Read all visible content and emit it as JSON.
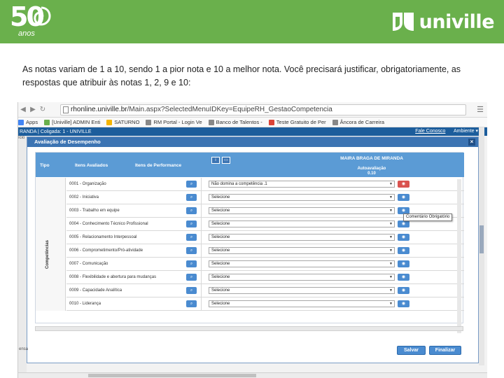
{
  "banner": {
    "logo_number": "50",
    "logo_sub": "anos",
    "brand": "univille",
    "color": "#6ab04c"
  },
  "intro_text": "As notas variam de 1 a 10, sendo 1 a pior nota e 10 a melhor nota. Você precisará justificar, obrigatoriamente, as respostas que atribuir às notas 1, 2, 9 e 10:",
  "browser": {
    "url_host": "rhonline.univille.br",
    "url_path": "/Main.aspx?SelectedMenuIDKey=EquipeRH_GestaoCompetencia",
    "bookmarks": [
      {
        "label": "Apps",
        "color": "#4285f4"
      },
      {
        "label": "[Univille] ADMIN Enti",
        "color": "#6ab04c"
      },
      {
        "label": "SATURNO",
        "color": "#f4b400"
      },
      {
        "label": "RM Portal - Login Ve",
        "color": "#888888"
      },
      {
        "label": "Banco de Talentos -",
        "color": "#888888"
      },
      {
        "label": "Teste Gratuito de Per",
        "color": "#db4437"
      },
      {
        "label": "Âncora de Carreira",
        "color": "#888888"
      }
    ]
  },
  "app_bar": {
    "left": "RANDA  |  Coligada: 1 - UNIVILLE",
    "fale": "Fale Conosco",
    "ambiente": "Ambiente ▾"
  },
  "left_strip": [
    "ício",
    "—",
    "—",
    "—",
    "—"
  ],
  "modal": {
    "title": "Avaliação de Desempenho",
    "close": "×",
    "col_tipo": "Tipo",
    "col_itens": "Itens Avaliados",
    "col_perf": "Itens de Performance",
    "employee": "MAIRA BRAGA DE MIRANDA",
    "autoav_label": "Autoavaliação",
    "autoav_score": "0.10",
    "category": "Competências",
    "rows": [
      {
        "item": "0001 - Organização",
        "value": "Não domina a competência .1",
        "comment_required": true
      },
      {
        "item": "0002 - Iniciativa",
        "value": "Selecione",
        "comment_required": false
      },
      {
        "item": "0003 - Trabalho em equipe",
        "value": "Selecione",
        "comment_required": false
      },
      {
        "item": "0004 - Conhecimento Técnico Profissional",
        "value": "Selecione",
        "comment_required": false
      },
      {
        "item": "0005 - Relacionamento Interpessoal",
        "value": "Selecione",
        "comment_required": false
      },
      {
        "item": "0006 - Comprometimento/Pró-atividade",
        "value": "Selecione",
        "comment_required": false
      },
      {
        "item": "0007 - Comunicação",
        "value": "Selecione",
        "comment_required": false
      },
      {
        "item": "0008 - Flexibilidade e abertura para mudanças",
        "value": "Selecione",
        "comment_required": false
      },
      {
        "item": "0009 - Capacidade Analítica",
        "value": "Selecione",
        "comment_required": false
      },
      {
        "item": "0010 - Liderança",
        "value": "Selecione",
        "comment_required": false
      }
    ],
    "tooltip": "Comentário Obrigatório",
    "salvar": "Salvar",
    "finalizar": "Finalizar",
    "footer_left": "ensa"
  },
  "colors": {
    "header_blue": "#3c74b3",
    "table_header": "#5b9bd5",
    "button_blue": "#4a8bd0",
    "required_red": "#d9534f"
  }
}
